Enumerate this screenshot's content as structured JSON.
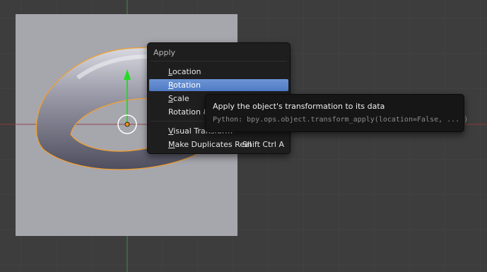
{
  "menu": {
    "title": "Apply",
    "items": [
      {
        "label": "Location",
        "mnemonic": "L",
        "rest": "ocation",
        "shortcut": "",
        "active": false
      },
      {
        "label": "Rotation",
        "mnemonic": "R",
        "rest": "otation",
        "shortcut": "",
        "active": true
      },
      {
        "label": "Scale",
        "mnemonic": "S",
        "rest": "cale",
        "shortcut": "",
        "active": false
      },
      {
        "label": "Rotation & Scale",
        "mnemonic": "",
        "rest": "Rotation & Scale",
        "shortcut": "",
        "active": false
      },
      {
        "label": "Visual Transform",
        "mnemonic": "V",
        "rest": "isual Transform",
        "shortcut": "",
        "active": false
      },
      {
        "label": "Make Duplicates Real",
        "mnemonic": "M",
        "rest": "ake Duplicates Real",
        "shortcut": "Shift Ctrl A",
        "active": false
      }
    ]
  },
  "tooltip": {
    "description": "Apply the object's transformation to its data",
    "python": "Python: bpy.ops.object.transform_apply(location=False, ... )"
  },
  "colors": {
    "viewport_bg": "#3d3d3d",
    "plane": "#a6a6ad",
    "selection_outline": "#f0a030",
    "axis_x": "#9a3a3a",
    "axis_y": "#3a8a3a",
    "manipulator_arrow": "#22dd22",
    "menu_highlight": "#5680c2"
  }
}
